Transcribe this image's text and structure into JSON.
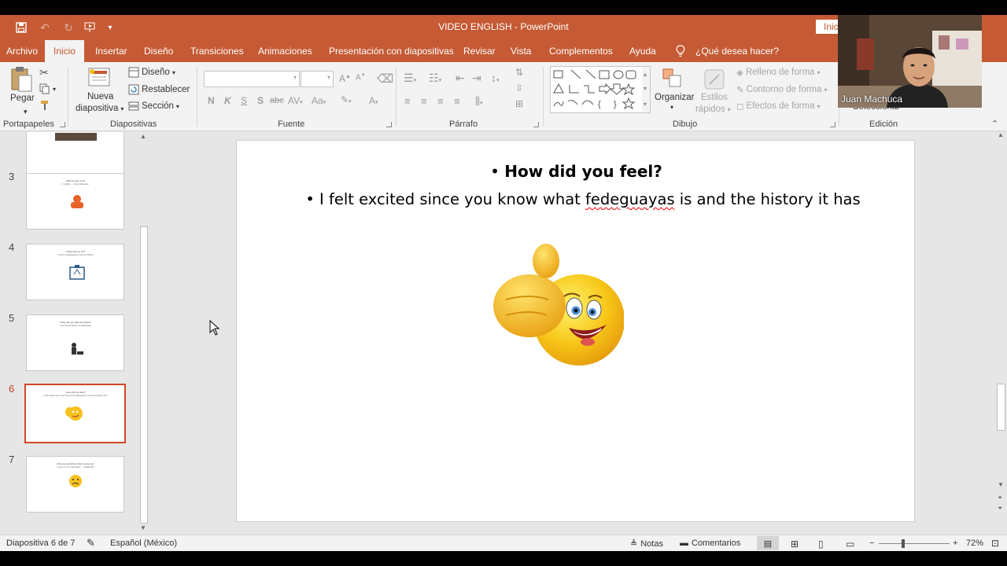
{
  "window": {
    "title": "VIDEO ENGLISH  -  PowerPoint",
    "signin_label": "Inic"
  },
  "tabs": [
    "Archivo",
    "Inicio",
    "Insertar",
    "Diseño",
    "Transiciones",
    "Animaciones",
    "Presentación con diapositivas",
    "Revisar",
    "Vista",
    "Complementos",
    "Ayuda"
  ],
  "tell_me": "¿Qué desea hacer?",
  "ribbon": {
    "clipboard": {
      "paste": "Pegar",
      "label": "Portapapeles"
    },
    "slides": {
      "new_slide_1": "Nueva",
      "new_slide_2": "diapositiva",
      "layout": "Diseño",
      "reset": "Restablecer",
      "section": "Sección",
      "label": "Diapositivas"
    },
    "font": {
      "label": "Fuente",
      "bold": "N",
      "italic": "K",
      "underline": "S",
      "shadow": "S",
      "strike": "abc"
    },
    "paragraph": {
      "label": "Párrafo"
    },
    "drawing": {
      "arrange": "Organizar",
      "quick_styles_1": "Estilos",
      "quick_styles_2": "rápidos",
      "fill": "Relleno de forma",
      "outline": "Contorno de forma",
      "effects": "Efectos de forma",
      "label": "Dibujo"
    },
    "editing": {
      "select": "Seleccionar",
      "label": "Edición"
    }
  },
  "webcam": {
    "name": "Juan Machuca"
  },
  "thumbnails": [
    {
      "num": "3",
      "title": "• Where were you?",
      "text": "• I visiting ... a memorial place"
    },
    {
      "num": "4",
      "title": "• What did you do?",
      "text": "• I went to fedeguayas to see the history"
    },
    {
      "num": "5",
      "title": "• Why did you take the photo?",
      "text": "• To know the history of fedeguayas"
    },
    {
      "num": "6",
      "title": "• How did you feel?",
      "text": "• I felt excited since you know what fedeguayas is and the history it has"
    },
    {
      "num": "7",
      "title": "• Did you send the photo to anyone?",
      "text": "• I sent it to my classmates ... confidential"
    }
  ],
  "slide": {
    "title": "How did you feel?",
    "body_prefix": "I felt excited since you know what ",
    "body_misspelled": "fedeguayas",
    "body_suffix": " is and the history it has"
  },
  "status": {
    "slide_info": "Diapositiva 6 de 7",
    "language": "Español (México)",
    "notes": "Notas",
    "comments": "Comentarios",
    "zoom": "72%"
  },
  "colors": {
    "accent": "#c55a34",
    "selected_thumb": "#d24726"
  }
}
